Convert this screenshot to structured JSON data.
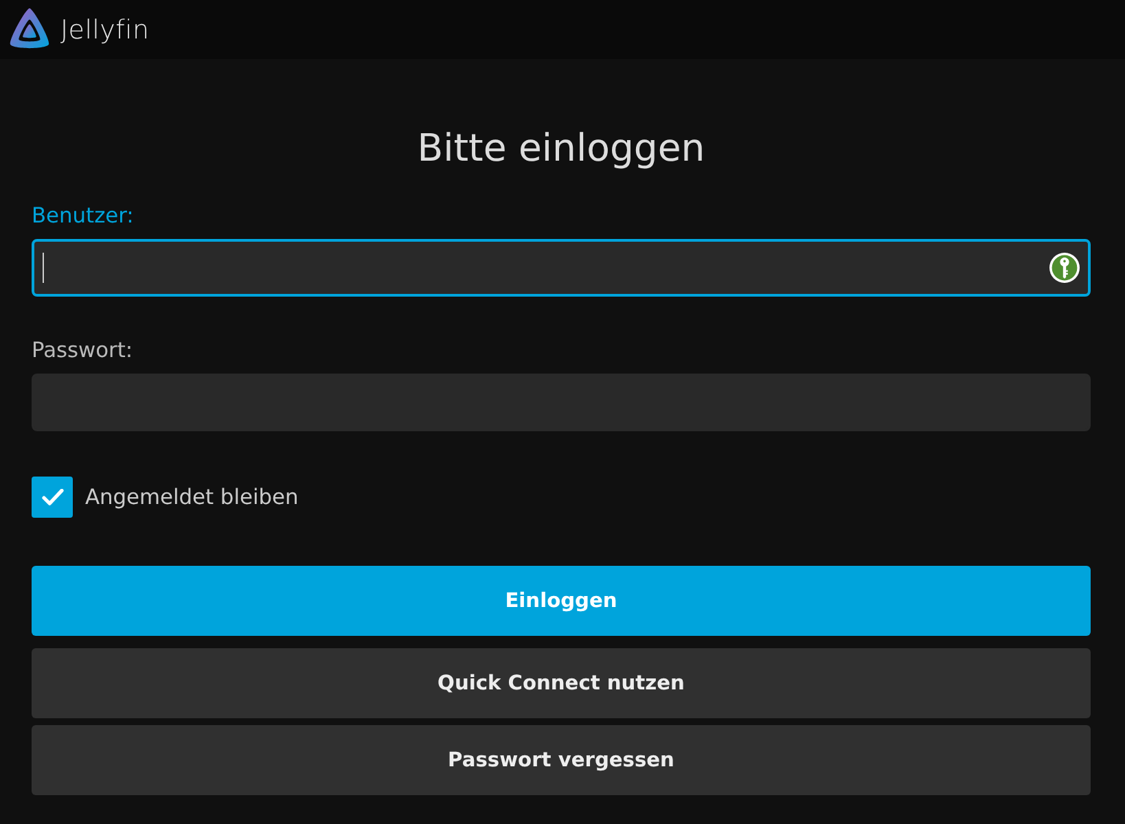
{
  "header": {
    "brand": "Jellyfin"
  },
  "title": "Bitte einloggen",
  "fields": [
    {
      "label": "Benutzer:",
      "focused": true,
      "key_icon": true
    },
    {
      "label": "Passwort:",
      "focused": false,
      "key_icon": false
    }
  ],
  "remember": {
    "label": "Angemeldet bleiben",
    "checked": true
  },
  "buttons": [
    {
      "label": "Einloggen",
      "kind": "primary"
    },
    {
      "label": "Quick Connect nutzen",
      "kind": "secondary"
    },
    {
      "label": "Passwort vergessen",
      "kind": "secondary"
    }
  ]
}
